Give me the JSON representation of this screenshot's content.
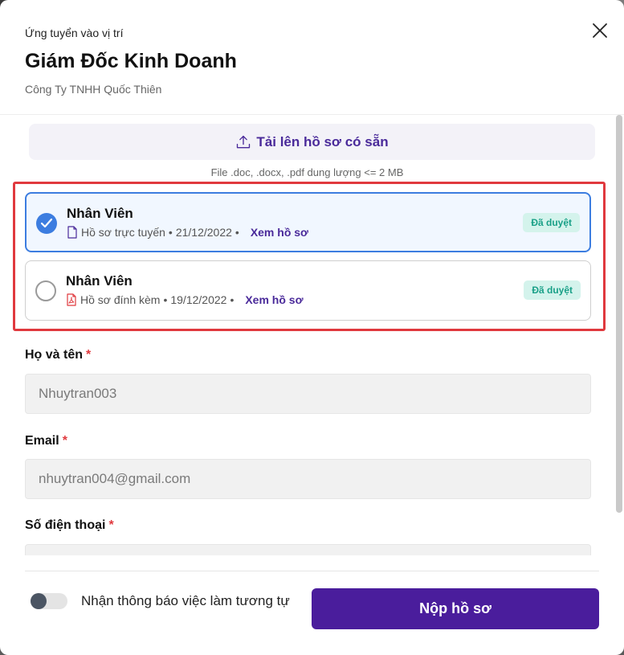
{
  "header": {
    "subtitle": "Ứng tuyển vào vị trí",
    "title": "Giám Đốc Kinh Doanh",
    "company": "Công Ty TNHH Quốc Thiên"
  },
  "upload": {
    "label": "Tải lên hồ sơ có sẵn",
    "note": "File .doc, .docx, .pdf dung lượng <= 2 MB"
  },
  "cvs": [
    {
      "name": "Nhân Viên",
      "type": "Hồ sơ trực tuyến",
      "date": "21/12/2022",
      "view": "Xem hồ sơ",
      "status": "Đã duyệt",
      "selected": true
    },
    {
      "name": "Nhân Viên",
      "type": "Hồ sơ đính kèm",
      "date": "19/12/2022",
      "view": "Xem hồ sơ",
      "status": "Đã duyệt",
      "selected": false
    }
  ],
  "form": {
    "fullname_label": "Họ và tên",
    "fullname_value": "Nhuytran003",
    "email_label": "Email",
    "email_value": "nhuytran004@gmail.com",
    "phone_label": "Số điện thoại",
    "required_mark": "*"
  },
  "footer": {
    "toggle_label": "Nhận thông báo việc làm tương tự",
    "toggle_on": false,
    "submit_label": "Nộp hồ sơ"
  },
  "colors": {
    "accent": "#4a1d9c",
    "selected_border": "#3c7de0",
    "badge_text": "#1aa088",
    "badge_bg": "#d4f3ec",
    "highlight": "#e0393e"
  }
}
